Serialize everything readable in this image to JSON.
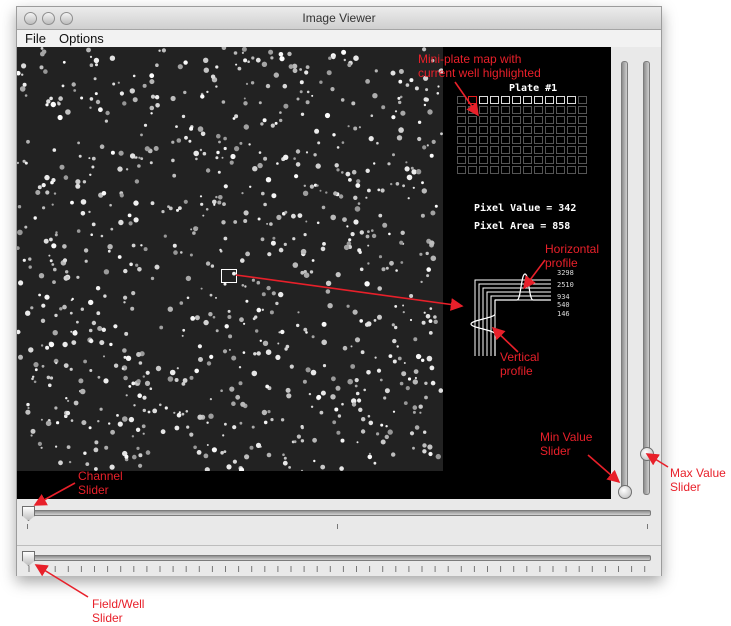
{
  "window": {
    "title": "Image Viewer"
  },
  "menu": {
    "items": [
      "File",
      "Options"
    ]
  },
  "overlay": {
    "plate_label": "Plate #1",
    "pixel_value": "Pixel Value = 342",
    "pixel_area": "Pixel Area = 858",
    "profile_ticks": [
      "3298",
      "2510",
      "934",
      "540",
      "146"
    ]
  },
  "annotations": {
    "plate_map": "Mini-plate map with\ncurrent well highlighted",
    "horizontal_profile": "Horizontal\nprofile",
    "vertical_profile": "Vertical\nprofile",
    "min_value_slider": "Min Value\nSlider",
    "max_value_slider": "Max Value\nSlider",
    "channel_slider": "Channel\nSlider",
    "field_well_slider": "Field/Well\nSlider"
  },
  "colors": {
    "annotation": "#e8202a",
    "highlight_well": "#e02020"
  }
}
